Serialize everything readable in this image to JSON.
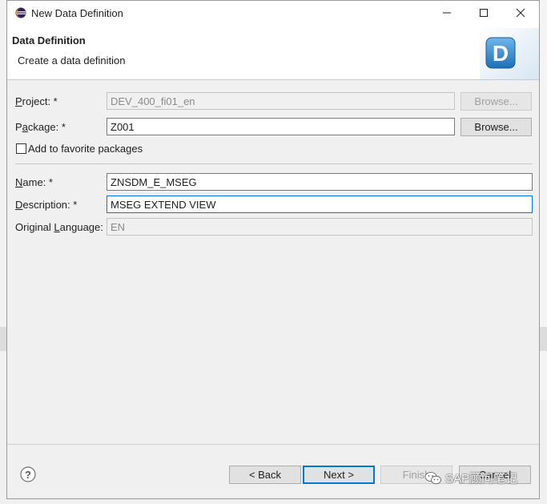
{
  "window": {
    "title": "New Data Definition",
    "minimize_glyph": "—",
    "maximize_glyph": "☐",
    "close_glyph": "✕"
  },
  "header": {
    "title": "Data Definition",
    "description": "Create a data definition",
    "logo_letter": "D"
  },
  "form": {
    "project": {
      "label": "Project: *",
      "value": "DEV_400_fi01_en",
      "browse": "Browse..."
    },
    "package": {
      "label": "Package: *",
      "value": "Z001",
      "browse": "Browse..."
    },
    "favorite": {
      "label": "Add to favorite packages",
      "checked": false
    },
    "name": {
      "label": "Name: *",
      "value": "ZNSDM_E_MSEG"
    },
    "description": {
      "label": "Description: *",
      "value": "MSEG EXTEND VIEW"
    },
    "language": {
      "label": "Original Language:",
      "value": "EN"
    }
  },
  "footer": {
    "back": "< Back",
    "next": "Next >",
    "finish": "Finish",
    "cancel": "Cancel"
  },
  "watermark": "SAP顾问笔记",
  "colors": {
    "accent": "#0078d7",
    "logo_blue": "#2b7fc4"
  }
}
